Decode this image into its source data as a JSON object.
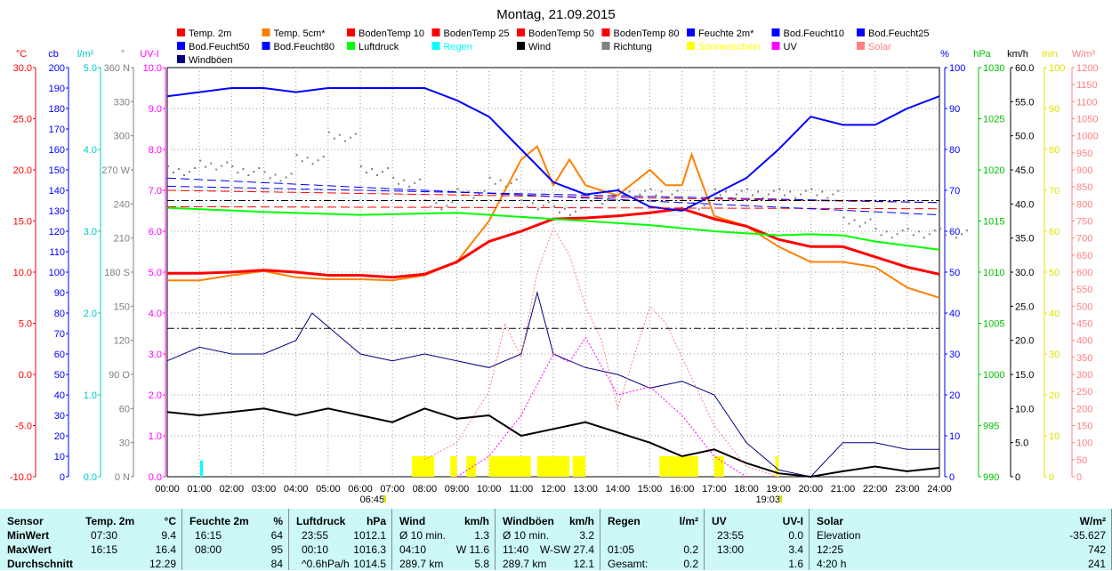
{
  "chart_data": {
    "type": "line",
    "title": "Montag, 21.09.2015",
    "x_ticks": [
      "00:00",
      "01:00",
      "02:00",
      "03:00",
      "04:00",
      "05:00",
      "06:00",
      "07:00",
      "08:00",
      "09:00",
      "10:00",
      "11:00",
      "12:00",
      "13:00",
      "14:00",
      "15:00",
      "16:00",
      "17:00",
      "18:00",
      "19:00",
      "20:00",
      "21:00",
      "22:00",
      "23:00",
      "24:00"
    ],
    "sunrise": "06:45",
    "sunset": "19:03",
    "axes": {
      "temp": {
        "label": "°C",
        "min": -10,
        "max": 30,
        "ticks": [
          "-10.0",
          "-5.0",
          "0.0",
          "5.0",
          "10.0",
          "15.0",
          "20.0",
          "25.0",
          "30.0"
        ],
        "color": "#ff0000"
      },
      "cb": {
        "label": "cb",
        "min": 0,
        "max": 200,
        "ticks": [
          "0",
          "10",
          "20",
          "30",
          "40",
          "50",
          "60",
          "70",
          "80",
          "90",
          "100",
          "110",
          "120",
          "130",
          "140",
          "150",
          "160",
          "170",
          "180",
          "190",
          "200"
        ],
        "color": "#0000ff"
      },
      "rain": {
        "label": "l/m²",
        "min": 0,
        "max": 5,
        "ticks": [
          "0.0",
          "1.0",
          "2.0",
          "3.0",
          "4.0",
          "5.0"
        ],
        "color": "#00c8c8"
      },
      "dir": {
        "label": "°",
        "min": 0,
        "max": 360,
        "ticks": [
          "0 N",
          "30",
          "60",
          "90 O",
          "120",
          "150",
          "180 S",
          "210",
          "240",
          "270 W",
          "300",
          "330",
          "360 N"
        ],
        "color": "#808080"
      },
      "uv": {
        "label": "UV-I",
        "min": 0,
        "max": 10,
        "ticks": [
          "0.0",
          "1.0",
          "2.0",
          "3.0",
          "4.0",
          "5.0",
          "6.0",
          "7.0",
          "8.0",
          "9.0",
          "10.0"
        ],
        "color": "#ff00ff"
      },
      "hum": {
        "label": "%",
        "min": 0,
        "max": 100,
        "ticks": [
          "0",
          "10",
          "20",
          "30",
          "40",
          "50",
          "60",
          "70",
          "80",
          "90",
          "100"
        ],
        "color": "#0000ff"
      },
      "press": {
        "label": "hPa",
        "min": 990,
        "max": 1030,
        "ticks": [
          "990",
          "995",
          "1000",
          "1005",
          "1010",
          "1015",
          "1020",
          "1025",
          "1030"
        ],
        "color": "#00c000"
      },
      "wind": {
        "label": "km/h",
        "min": 0,
        "max": 60,
        "ticks": [
          "0",
          "5.0",
          "10.0",
          "15.0",
          "20.0",
          "25.0",
          "30.0",
          "35.0",
          "40.0",
          "45.0",
          "50.0",
          "55.0",
          "60.0"
        ],
        "color": "#000000"
      },
      "sun": {
        "label": "min",
        "min": 0,
        "max": 100,
        "ticks": [
          "0",
          "10",
          "20",
          "30",
          "40",
          "50",
          "60",
          "70",
          "80",
          "90",
          "100"
        ],
        "color": "#e0e000"
      },
      "solar": {
        "label": "W/m²",
        "min": 0,
        "max": 1200,
        "ticks": [
          "0",
          "50",
          "100",
          "150",
          "200",
          "250",
          "300",
          "350",
          "400",
          "450",
          "500",
          "550",
          "600",
          "650",
          "700",
          "750",
          "800",
          "850",
          "900",
          "950",
          "1000",
          "1050",
          "1100",
          "1150",
          "1200"
        ],
        "color": "#ff8080"
      }
    },
    "legend": [
      {
        "name": "Temp. 2m",
        "color": "#ff0000"
      },
      {
        "name": "Temp. 5cm*",
        "color": "#ff8000"
      },
      {
        "name": "BodenTemp 10",
        "color": "#ff0000"
      },
      {
        "name": "BodenTemp 25",
        "color": "#ff0000"
      },
      {
        "name": "BodenTemp 50",
        "color": "#ff0000"
      },
      {
        "name": "BodenTemp 80",
        "color": "#ff0000"
      },
      {
        "name": "Feuchte 2m*",
        "color": "#0000ff"
      },
      {
        "name": "Bod.Feucht10",
        "color": "#0000ff"
      },
      {
        "name": "Bod.Feucht25",
        "color": "#0000ff"
      },
      {
        "name": "Bod.Feucht50",
        "color": "#0000ff"
      },
      {
        "name": "Bod.Feucht80",
        "color": "#0000ff"
      },
      {
        "name": "Luftdruck",
        "color": "#00ff00"
      },
      {
        "name": "Regen",
        "color": "#00ffff"
      },
      {
        "name": "Wind",
        "color": "#000000"
      },
      {
        "name": "Richtung",
        "color": "#808080"
      },
      {
        "name": "Sonnenschein",
        "color": "#ffff00"
      },
      {
        "name": "UV",
        "color": "#ff00ff"
      },
      {
        "name": "Solar",
        "color": "#ff8080"
      },
      {
        "name": "Windböen",
        "color": "#000080"
      }
    ],
    "series": [
      {
        "name": "Temp. 5cm*",
        "axis": "temp",
        "color": "#ff8000",
        "width": 2,
        "x": [
          0,
          1,
          2,
          3,
          4,
          5,
          6,
          7,
          8,
          9,
          10,
          11,
          11.5,
          12,
          12.5,
          13,
          14,
          15,
          15.5,
          16,
          16.3,
          17,
          18,
          19,
          20,
          21,
          22,
          23,
          24
        ],
        "y": [
          9.2,
          9.2,
          9.7,
          10.1,
          9.5,
          9.3,
          9.3,
          9.2,
          9.7,
          11,
          15,
          21,
          22.3,
          18.5,
          21,
          18.5,
          17.5,
          20,
          18.5,
          18.5,
          21.5,
          15.5,
          14.5,
          12.5,
          11,
          11,
          10.5,
          8.5,
          7.5
        ]
      },
      {
        "name": "Temp. 2m",
        "axis": "temp",
        "color": "#ff0000",
        "width": 3,
        "x": [
          0,
          1,
          2,
          3,
          4,
          5,
          6,
          7,
          8,
          9,
          10,
          11,
          12,
          13,
          14,
          15,
          16,
          17,
          18,
          19,
          20,
          21,
          22,
          23,
          24
        ],
        "y": [
          9.9,
          9.9,
          10,
          10.2,
          10,
          9.7,
          9.7,
          9.5,
          9.8,
          11,
          13,
          14,
          15.2,
          15.3,
          15.5,
          15.8,
          16.2,
          15.2,
          14.5,
          13.2,
          12.5,
          12.5,
          11.5,
          10.5,
          9.8
        ]
      },
      {
        "name": "Feuchte 2m*",
        "axis": "hum",
        "color": "#0000ff",
        "width": 2,
        "x": [
          0,
          1,
          2,
          3,
          4,
          5,
          6,
          7,
          8,
          9,
          10,
          11,
          12,
          13,
          14,
          15,
          16,
          17,
          18,
          19,
          20,
          21,
          22,
          23,
          24
        ],
        "y": [
          93,
          94,
          95,
          95,
          94,
          95,
          95,
          95,
          95,
          92,
          88,
          80,
          72,
          69,
          70,
          66,
          65,
          69,
          73,
          80,
          88,
          86,
          86,
          90,
          93
        ]
      },
      {
        "name": "Luftdruck",
        "axis": "press",
        "color": "#00ff00",
        "width": 2,
        "x": [
          0,
          3,
          6,
          9,
          12,
          15,
          17,
          19,
          20,
          21,
          22,
          24
        ],
        "y": [
          1016.3,
          1015.9,
          1015.6,
          1015.8,
          1015.2,
          1014.6,
          1014.0,
          1013.6,
          1013.7,
          1013.6,
          1013.0,
          1012.2
        ]
      },
      {
        "name": "Windböen",
        "axis": "wind",
        "color": "#000080",
        "width": 1,
        "x": [
          0,
          1,
          2,
          3,
          4,
          4.5,
          5,
          6,
          7,
          8,
          9,
          10,
          11,
          11.5,
          12,
          13,
          14,
          15,
          16,
          17,
          18,
          19,
          20,
          21,
          22,
          23,
          24
        ],
        "y": [
          17,
          19,
          18,
          18,
          20,
          24,
          22,
          18,
          17,
          18,
          17,
          16,
          18,
          27,
          18,
          16,
          15,
          13,
          14,
          12,
          5,
          1,
          0,
          5,
          5,
          4,
          4
        ]
      },
      {
        "name": "Wind",
        "axis": "wind",
        "color": "#000000",
        "width": 2,
        "x": [
          0,
          1,
          2,
          3,
          4,
          5,
          6,
          7,
          8,
          9,
          10,
          11,
          12,
          13,
          14,
          15,
          16,
          17,
          18,
          19,
          20,
          21,
          22,
          23,
          24
        ],
        "y": [
          9.5,
          9,
          9.5,
          10,
          9,
          10,
          9,
          8,
          10,
          8.5,
          9,
          6,
          7,
          8,
          6.5,
          5,
          3,
          4,
          2,
          0.5,
          0,
          0.8,
          1.5,
          0.8,
          1.3
        ]
      },
      {
        "name": "Solar",
        "axis": "solar",
        "color": "#ff8080",
        "width": 1,
        "dash": "2,2",
        "x": [
          8,
          9,
          10,
          10.5,
          11,
          11.5,
          12,
          12.5,
          13,
          13.5,
          14,
          14.5,
          15,
          15.5,
          16,
          17,
          18,
          19
        ],
        "y": [
          50,
          100,
          250,
          450,
          350,
          600,
          730,
          650,
          500,
          400,
          200,
          350,
          500,
          450,
          350,
          150,
          30,
          0
        ]
      },
      {
        "name": "UV",
        "axis": "uv",
        "color": "#ff00ff",
        "width": 1,
        "dash": "2,2",
        "x": [
          9,
          10,
          11,
          12,
          12.5,
          13,
          14,
          15,
          16,
          17,
          18
        ],
        "y": [
          0,
          0.5,
          1.5,
          3,
          2.8,
          3.4,
          2,
          2.2,
          1.5,
          0.5,
          0
        ]
      },
      {
        "name": "BodenTemp 10",
        "axis": "temp",
        "color": "#ff0000",
        "width": 1,
        "dash": "10,5",
        "x": [
          0,
          24
        ],
        "y": [
          18.0,
          16.8
        ]
      },
      {
        "name": "BodenTemp 25",
        "axis": "temp",
        "color": "#ff0000",
        "width": 1,
        "dash": "10,5",
        "x": [
          0,
          24
        ],
        "y": [
          16.4,
          16.2
        ]
      },
      {
        "name": "Bod.Feucht10",
        "axis": "hum",
        "color": "#0000ff",
        "width": 1,
        "dash": "10,5",
        "x": [
          0,
          24
        ],
        "y": [
          73,
          64
        ]
      },
      {
        "name": "Bod.Feucht25",
        "axis": "hum",
        "color": "#0000ff",
        "width": 1,
        "dash": "10,5",
        "x": [
          0,
          24
        ],
        "y": [
          71,
          67
        ]
      },
      {
        "name": "BodenTemp 50",
        "axis": "temp",
        "color": "#000000",
        "width": 1,
        "dash": "8,3,2,3",
        "x": [
          0,
          24
        ],
        "y": [
          17.0,
          17.0
        ]
      },
      {
        "name": "BodenTemp 80",
        "axis": "temp",
        "color": "#000000",
        "width": 1,
        "dash": "8,3,2,3",
        "x": [
          0,
          24
        ],
        "y": [
          4.5,
          4.5
        ]
      }
    ],
    "richtung": {
      "axis": "dir",
      "x": [
        0,
        1,
        2,
        3,
        4,
        5,
        6,
        7,
        8,
        9,
        10,
        11,
        12,
        13,
        14,
        15,
        16,
        17,
        18,
        19,
        20,
        21,
        22,
        23,
        24
      ],
      "y": [
        270,
        275,
        270,
        265,
        280,
        300,
        270,
        260,
        240,
        250,
        260,
        240,
        235,
        245,
        250,
        250,
        240,
        250,
        250,
        250,
        250,
        225,
        215,
        215,
        215
      ]
    },
    "sunshine": {
      "axis": "sun",
      "intervals": [
        [
          7.6,
          8.3
        ],
        [
          8.8,
          9.0
        ],
        [
          9.3,
          9.6
        ],
        [
          10.0,
          11.3
        ],
        [
          11.5,
          12.5
        ],
        [
          12.6,
          13.0
        ],
        [
          15.3,
          16.5
        ],
        [
          17.0,
          17.3
        ],
        [
          18.9,
          19.0
        ]
      ],
      "value": 5
    },
    "rain": {
      "axis": "rain",
      "x": [
        1.05
      ],
      "y": 0.2
    }
  },
  "table": {
    "columns": [
      {
        "title": "Sensor",
        "unit": "",
        "rows": [
          [
            "MinWert",
            ""
          ],
          [
            "MaxWert",
            ""
          ],
          [
            "Durchschnitt",
            ""
          ]
        ]
      },
      {
        "title": "Temp. 2m",
        "unit": "°C",
        "rows": [
          [
            "07:30",
            "9.4"
          ],
          [
            "16:15",
            "16.4"
          ],
          [
            "",
            "12.29"
          ]
        ]
      },
      {
        "title": "Feuchte 2m",
        "unit": "%",
        "rows": [
          [
            "16:15",
            "64"
          ],
          [
            "08:00",
            "95"
          ],
          [
            "",
            "84"
          ]
        ]
      },
      {
        "title": "Luftdruck",
        "unit": "hPa",
        "rows": [
          [
            "23:55",
            "1012.1"
          ],
          [
            "00:10",
            "1016.3"
          ],
          [
            "^0.6hPa/h",
            "1014.5"
          ]
        ]
      },
      {
        "title": "Wind",
        "unit": "km/h",
        "rows": [
          [
            "Ø 10 min.",
            "1.3"
          ],
          [
            "04:10",
            "W 11.6"
          ],
          [
            "289.7 km",
            "5.8"
          ]
        ]
      },
      {
        "title": "Windböen",
        "unit": "km/h",
        "rows": [
          [
            "Ø 10 min.",
            "3.2"
          ],
          [
            "11:40",
            "W-SW 27.4"
          ],
          [
            "289.7 km",
            "12.1"
          ]
        ]
      },
      {
        "title": "Regen",
        "unit": "l/m²",
        "rows": [
          [
            "",
            ""
          ],
          [
            "01:05",
            "0.2"
          ],
          [
            "Gesamt:",
            "0.2"
          ]
        ]
      },
      {
        "title": "UV",
        "unit": "UV-I",
        "rows": [
          [
            "23:55",
            "0.0"
          ],
          [
            "13:00",
            "3.4"
          ],
          [
            "",
            "1.6"
          ]
        ]
      },
      {
        "title": "Solar",
        "unit": "W/m²",
        "rows": [
          [
            "Elevation",
            "-35.627"
          ],
          [
            "12:25",
            "742"
          ],
          [
            "4:20 h",
            "241"
          ]
        ]
      }
    ]
  }
}
